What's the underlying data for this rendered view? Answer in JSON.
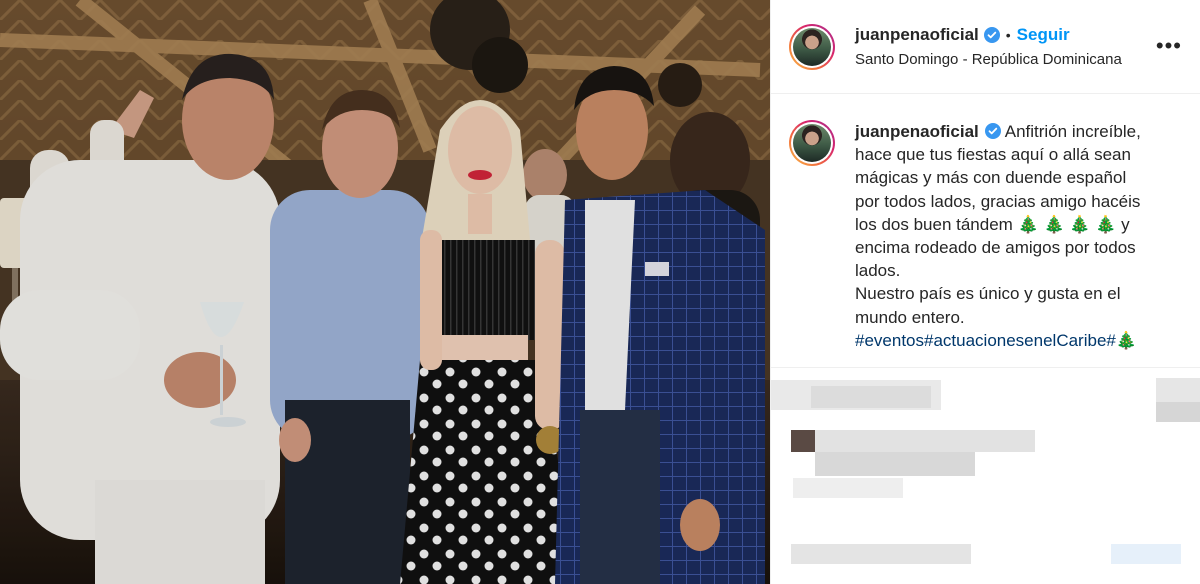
{
  "post": {
    "username": "juanpenaoficial",
    "verified_icon": "verified-badge-icon",
    "separator": "•",
    "follow_label": "Seguir",
    "location": "Santo Domingo - República Dominicana",
    "more_label": "•••",
    "caption": {
      "lines": [
        "Anfitrión increíble,",
        "hace que tus fiestas aquí o allá sean",
        "mágicas y más con duende español",
        "por todos lados, gracias amigo hacéis",
        "los dos buen tándem 🎄 🎄 🎄 🎄 y",
        "encima rodeado de amigos por todos",
        "lados.",
        "Nuestro país es único y gusta en el",
        "mundo entero."
      ],
      "hashtags": "#eventos#actuacionesenelCaribe#🎄"
    }
  },
  "colors": {
    "link_blue": "#0095f6",
    "hashtag_blue": "#00376b",
    "verified_blue": "#3897f0",
    "divider": "#efefef"
  }
}
